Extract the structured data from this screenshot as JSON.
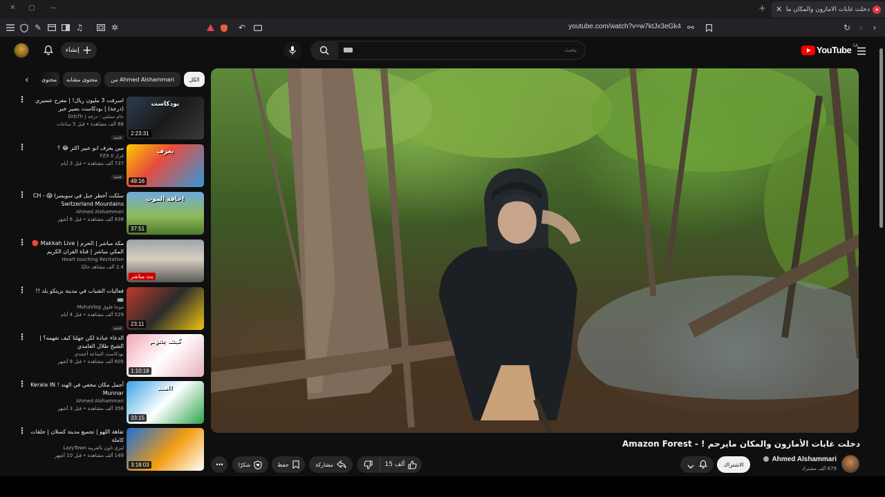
{
  "browser": {
    "tab_title": "دخلت غابات الأمازون والمكان ما...",
    "url": "youtube.com/watch?v=w7ktJx3eGk4"
  },
  "masthead": {
    "create_label": "إنشاء",
    "search_placeholder": "بحث",
    "logo_text": "YouTube",
    "logo_country": "SA"
  },
  "chips": [
    {
      "label": "الكل",
      "active": true
    },
    {
      "label": "من Ahmed Alshammari",
      "active": false
    },
    {
      "label": "محتوى مشابه",
      "active": false
    },
    {
      "label": "محتوى",
      "active": false
    }
  ],
  "recommendations": [
    {
      "title": "اسرفت 3 مليون ريال! | مفرح عسيري (درجة) | بودكاست بصير خير",
      "channel": "عام ستثني · درجة | Drb7h",
      "meta": "66 ألف مشاهدة • قبل 5 ساعات",
      "badge": "جديد",
      "duration": "2:23:31"
    },
    {
      "title": "مين يعرف ابو عبير اكثر 😂 ؟",
      "channel": "فراز FZX II",
      "meta": "737 ألف مشاهدة • قبل 3 أيام",
      "badge": "جديد",
      "duration": "49:16"
    },
    {
      "title": "سلكت أخطر جبل في سويسرا 😱 - CH Switzerland Mountains",
      "channel": "Ahmed Alshammari",
      "meta": "938 ألف مشاهدة • قبل 6 أشهر",
      "badge": "",
      "duration": "37:51"
    },
    {
      "title": "مكة مباشر | الحرم | Makkah Live 🔴 المكي مباشر | قناة القران الكريم السعودية ...",
      "channel": "Heart touching Recitation",
      "meta": "2.4 ألف مشاهد حاليًا",
      "badge": "",
      "duration": "بث مباشر"
    },
    {
      "title": "فعاليات الشباب في مدينة بريتكو بلد !! 🚌",
      "channel": "موجا فلوق MohaVlog",
      "meta": "529 ألف مشاهدة • قبل 4 أيام",
      "badge": "جديد",
      "duration": "23:11"
    },
    {
      "title": "الدعاء عبادة لكن جهلنا كيف نفهمه؟ | الشيخ طلال الغامدي",
      "channel": "بودكاست الساعة أحمدي",
      "meta": "605 ألف مشاهدة • قبل 9 أشهر",
      "badge": "",
      "duration": "1:10:18"
    },
    {
      "title": "أجمل مكان مخفي في الهند ! Kerala IN Munnar",
      "channel": "Ahmed Alshammari",
      "meta": "356 ألف مشاهدة • قبل 3 أشهر",
      "badge": "",
      "duration": "33:15"
    },
    {
      "title": "تفاهة اللهو | تجميع مدينة كسلان | حلقات كاملة",
      "channel": "ليزي تاون بالعربية LazyTown",
      "meta": "149 ألف مشاهدة • قبل 10 أشهر",
      "badge": "",
      "duration": "3:18:03"
    }
  ],
  "thumb_overlays": [
    "بودكاست",
    "يعرف",
    "حافة الموت!",
    "",
    "",
    "كيف يفهم",
    "اهند!",
    ""
  ],
  "video": {
    "title": "دخلت غابات الأمازون والمكان مايرحم ! - Amazon Forest",
    "channel": "Ahmed Alshammari",
    "subscribers": "679 ألف مشترك",
    "subscribe_label": "الاشتراك",
    "likes": "15 ألف",
    "share_label": "مشاركة",
    "save_label": "حفظ",
    "thanks_label": "شكرًا"
  },
  "colors": {
    "accent_red": "#ff0000",
    "background": "#0f0f0f",
    "chip": "#272727"
  }
}
